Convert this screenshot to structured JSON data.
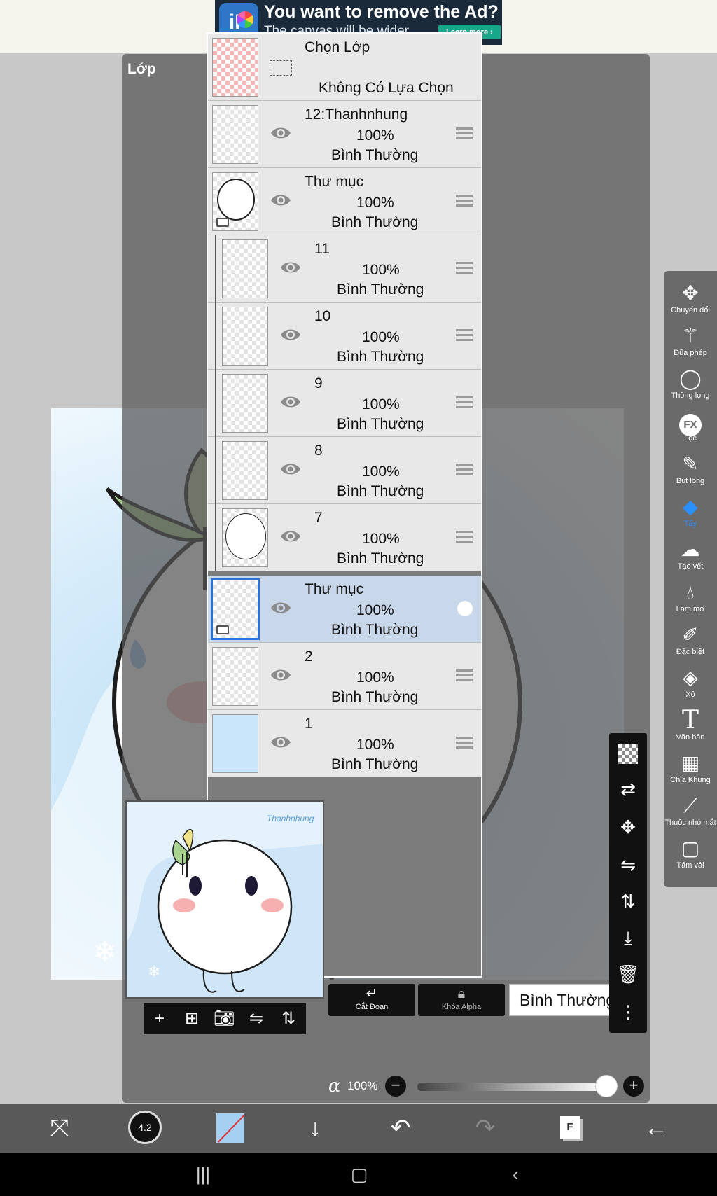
{
  "ad": {
    "title": "You want to remove the Ad?",
    "subtitle": "The canvas will be wider.",
    "button": "Learn more ›",
    "logo_letters": "iP"
  },
  "dialog": {
    "title": "Lớp"
  },
  "selection_layer": {
    "name": "Chọn Lớp",
    "status": "Không Có Lựa Chọn"
  },
  "layers": [
    {
      "name": "12:Thanhnhung",
      "opacity": "100%",
      "mode": "Bình Thường"
    },
    {
      "name": "Thư mục",
      "opacity": "100%",
      "mode": "Bình Thường"
    },
    {
      "name": "11",
      "opacity": "100%",
      "mode": "Bình Thường"
    },
    {
      "name": "10",
      "opacity": "100%",
      "mode": "Bình Thường"
    },
    {
      "name": "9",
      "opacity": "100%",
      "mode": "Bình Thường"
    },
    {
      "name": "8",
      "opacity": "100%",
      "mode": "Bình Thường"
    },
    {
      "name": "7",
      "opacity": "100%",
      "mode": "Bình Thường"
    },
    {
      "name": "Thư mục",
      "opacity": "100%",
      "mode": "Bình Thường"
    },
    {
      "name": "2",
      "opacity": "100%",
      "mode": "Bình Thường"
    },
    {
      "name": "1",
      "opacity": "100%",
      "mode": "Bình Thường"
    }
  ],
  "controls": {
    "clip_label": "Cắt Đoạn",
    "alpha_lock_label": "Khóa Alpha",
    "blend_mode": "Bình Thường",
    "alpha_symbol": "α",
    "alpha_value": "100%",
    "alpha_level": 1.0
  },
  "tools": [
    {
      "label": "Chuyển đổi",
      "icon": "move-arrows-icon"
    },
    {
      "label": "Đũa phép",
      "icon": "magic-wand-icon"
    },
    {
      "label": "Thông lọng",
      "icon": "lasso-icon"
    },
    {
      "label": "Lọc",
      "icon": "fx-icon"
    },
    {
      "label": "Bút lông",
      "icon": "brush-icon"
    },
    {
      "label": "Tẩy",
      "icon": "eraser-icon"
    },
    {
      "label": "Tạo vết",
      "icon": "smudge-icon"
    },
    {
      "label": "Làm mờ",
      "icon": "blur-drop-icon"
    },
    {
      "label": "Đặc biệt",
      "icon": "special-pen-icon"
    },
    {
      "label": "Xô",
      "icon": "bucket-icon"
    },
    {
      "label": "Văn bản",
      "icon": "text-icon"
    },
    {
      "label": "Chia Khung",
      "icon": "frame-divide-icon"
    },
    {
      "label": "Thuốc nhỏ mắt",
      "icon": "eyedropper-icon"
    },
    {
      "label": "Tấm vải",
      "icon": "canvas-icon"
    }
  ],
  "toolbar": {
    "brush_size": "4.2",
    "frame_letter": "F"
  },
  "colors": {
    "accent": "#2a8fff",
    "selected_row": "#c9d7ea",
    "selected_thumb_border": "#2b72d6",
    "current_color": "#a6d0f2"
  }
}
